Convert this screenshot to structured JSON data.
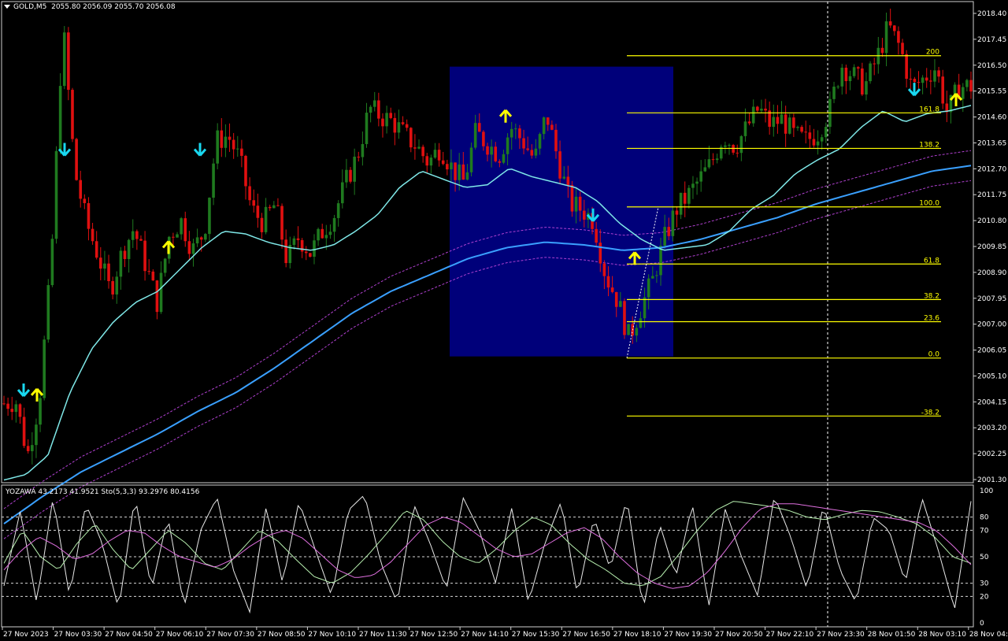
{
  "header": {
    "symbol": "GOLD,M5",
    "ohlc": "2055.80 2056.09 2055.70 2056.08"
  },
  "indicator_header": "YOZAWA 43.2173 41.9521  Sto(5,3,3) 93.2976 80.4156",
  "colors": {
    "background": "#000000",
    "bull": "#1f7a1f",
    "bear": "#e01010",
    "ma_fast": "#7fe8e8",
    "ma_slow": "#3aa0ff",
    "envelope": "#b040d0",
    "fib": "#ffff00",
    "box": "#00007a",
    "arrow_up": "#ffff00",
    "arrow_down": "#19d8f0",
    "grid": "#ffffff",
    "osc_white": "#e8e8e8",
    "osc_green": "#b8f0b0",
    "osc_pink": "#e070e0"
  },
  "chart_data": [
    {
      "type": "candlestick",
      "title": "GOLD,M5",
      "ylim": [
        2001.0,
        2018.6
      ],
      "y_ticks": [
        "2018.40",
        "2017.45",
        "2016.50",
        "2015.55",
        "2014.60",
        "2013.65",
        "2012.70",
        "2011.75",
        "2010.80",
        "2009.85",
        "2008.90",
        "2007.95",
        "2007.00",
        "2006.05",
        "2005.10",
        "2004.15",
        "2003.20",
        "2002.25",
        "2001.30"
      ],
      "x_ticks": [
        "27 Nov 2023",
        "27 Nov 03:30",
        "27 Nov 04:50",
        "27 Nov 06:10",
        "27 Nov 07:30",
        "27 Nov 08:50",
        "27 Nov 10:10",
        "27 Nov 11:30",
        "27 Nov 12:50",
        "27 Nov 14:10",
        "27 Nov 15:30",
        "27 Nov 16:50",
        "27 Nov 18:10",
        "27 Nov 19:30",
        "27 Nov 20:50",
        "27 Nov 22:10",
        "27 Nov 23:30",
        "28 Nov 01:50",
        "28 Nov 03:10",
        "28 Nov 04:30"
      ],
      "close_path": [
        2003.9,
        2004.0,
        2002.0,
        2004.0,
        2009.0,
        2017.8,
        2012.4,
        2010.5,
        2009.3,
        2008.0,
        2009.4,
        2010.3,
        2009.0,
        2007.6,
        2010.0,
        2010.6,
        2009.5,
        2010.2,
        2013.5,
        2013.7,
        2012.8,
        2011.0,
        2010.5,
        2011.2,
        2009.1,
        2010.0,
        2009.4,
        2010.2,
        2010.8,
        2012.0,
        2013.0,
        2014.7,
        2014.4,
        2014.2,
        2013.7,
        2013.3,
        2012.7,
        2013.3,
        2012.5,
        2012.0,
        2013.8,
        2013.4,
        2013.0,
        2014.0,
        2013.5,
        2012.8,
        2014.5,
        2012.8,
        2011.2,
        2011.0,
        2010.6,
        2008.6,
        2007.7,
        2006.3,
        2007.4,
        2008.4,
        2009.9,
        2011.0,
        2011.5,
        2012.1,
        2012.7,
        2013.7,
        2013.3,
        2014.0,
        2014.7,
        2014.1,
        2014.3,
        2013.7,
        2013.5,
        2013.8,
        2014.6,
        2016.3,
        2015.9,
        2015.5,
        2016.5,
        2017.7,
        2016.9,
        2015.4,
        2015.8,
        2016.2,
        2014.5,
        2015.5,
        2015.5
      ],
      "ma_fast_path": [
        2001.1,
        2001.3,
        2002.0,
        2004.3,
        2005.9,
        2006.9,
        2007.6,
        2008.0,
        2008.8,
        2009.6,
        2010.2,
        2010.1,
        2009.8,
        2009.6,
        2009.5,
        2009.7,
        2010.2,
        2010.8,
        2011.8,
        2012.4,
        2012.1,
        2011.8,
        2011.9,
        2012.5,
        2012.2,
        2012.0,
        2011.8,
        2011.3,
        2010.5,
        2009.9,
        2009.5,
        2009.6,
        2009.7,
        2010.2,
        2011.0,
        2011.5,
        2012.3,
        2012.8,
        2013.2,
        2014.0,
        2014.6,
        2014.2,
        2014.5,
        2014.6,
        2014.8
      ],
      "ma_slow_path": [
        1999.5,
        2000.5,
        2001.4,
        2002.1,
        2002.8,
        2003.6,
        2004.3,
        2005.2,
        2006.2,
        2007.2,
        2008.0,
        2008.6,
        2009.2,
        2009.6,
        2009.8,
        2009.7,
        2009.5,
        2009.6,
        2009.9,
        2010.3,
        2010.7,
        2011.2,
        2011.6,
        2012.0,
        2012.4,
        2012.6
      ],
      "envelope_offset": 0.55,
      "fibonacci": {
        "levels": [
          "200",
          "161.8",
          "138.2",
          "100.0",
          "61.8",
          "38.2",
          "23.6",
          "0.0",
          "-38.2"
        ],
        "prices": [
          2016.62,
          2014.53,
          2013.23,
          2011.09,
          2009.0,
          2007.7,
          2006.89,
          2005.56,
          2003.44
        ]
      },
      "highlight_box": {
        "y_range": [
          2005.62,
          2016.22
        ]
      },
      "arrows": [
        {
          "dir": "down",
          "price": 2004.4
        },
        {
          "dir": "up",
          "price": 2004.2
        },
        {
          "dir": "down",
          "price": 2013.2
        },
        {
          "dir": "up",
          "price": 2009.6
        },
        {
          "dir": "down",
          "price": 2013.2
        },
        {
          "dir": "up",
          "price": 2014.4
        },
        {
          "dir": "down",
          "price": 2010.8
        },
        {
          "dir": "up",
          "price": 2009.2
        },
        {
          "dir": "down",
          "price": 2015.4
        },
        {
          "dir": "up",
          "price": 2015.0
        }
      ]
    },
    {
      "type": "line",
      "title": "YOZAWA / Sto(5,3,3)",
      "ylim": [
        0,
        100
      ],
      "y_ticks": [
        100,
        80,
        70,
        50,
        30,
        20,
        0
      ],
      "levels": [
        80,
        70,
        50,
        30,
        20
      ],
      "series": [
        {
          "name": "Sto(5,3,3) main",
          "values": [
            28,
            85,
            15,
            95,
            20,
            90,
            60,
            10,
            96,
            25,
            80,
            12,
            70,
            95,
            40,
            8,
            88,
            30,
            92,
            55,
            20,
            85,
            97,
            45,
            15,
            90,
            60,
            25,
            95,
            70,
            30,
            88,
            15,
            60,
            92,
            20,
            80,
            40,
            95,
            10,
            75,
            35,
            90,
            12,
            86,
            50,
            20,
            96,
            65,
            25,
            90,
            40,
            15,
            80,
            70,
            30,
            95,
            55,
            10,
            92
          ]
        },
        {
          "name": "YOZAWA 1",
          "values": [
            45,
            70,
            50,
            40,
            60,
            75,
            55,
            40,
            55,
            70,
            60,
            45,
            40,
            55,
            70,
            62,
            48,
            35,
            30,
            38,
            52,
            68,
            85,
            78,
            62,
            50,
            45,
            56,
            70,
            80,
            74,
            60,
            48,
            40,
            30,
            28,
            35,
            52,
            70,
            85,
            92,
            90,
            88,
            85,
            80,
            78,
            82,
            85,
            84,
            80,
            75,
            65,
            50,
            45
          ]
        },
        {
          "name": "YOZAWA 2",
          "values": [
            40,
            55,
            65,
            58,
            48,
            52,
            62,
            70,
            68,
            58,
            50,
            46,
            42,
            48,
            58,
            66,
            70,
            64,
            52,
            40,
            34,
            36,
            46,
            60,
            74,
            80,
            76,
            66,
            56,
            50,
            52,
            60,
            68,
            72,
            64,
            50,
            38,
            30,
            26,
            28,
            38,
            54,
            72,
            86,
            90,
            90,
            88,
            86,
            84,
            82,
            80,
            78,
            76,
            70,
            58,
            44
          ]
        }
      ]
    }
  ]
}
